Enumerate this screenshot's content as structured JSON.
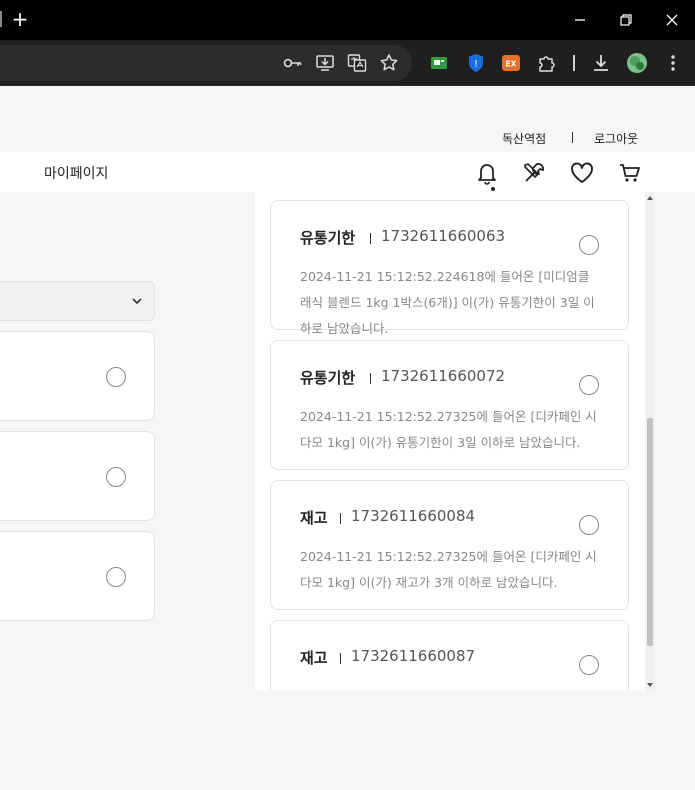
{
  "browser": {
    "new_tab_symbol": "+",
    "toolbar_icons": [
      "key-icon",
      "install-app-icon",
      "translate-icon",
      "bookmark-star-icon",
      "extension-green-icon",
      "shield-extension-icon",
      "ex-extension-icon",
      "puzzle-extensions-icon",
      "download-icon",
      "profile-avatar",
      "more-menu-icon"
    ],
    "ex_badge": "EX",
    "shield_badge": "!"
  },
  "header": {
    "util_links": [
      "독산역점",
      "로그아웃"
    ]
  },
  "nav": {
    "mypage_label": "마이페이지",
    "icons": [
      "bell-icon",
      "tools-icon",
      "heart-icon",
      "cart-icon"
    ]
  },
  "notifications": [
    {
      "type": "유통기한",
      "id": "1732611660063",
      "message": "2024-11-21 15:12:52.224618에 들어온 [미디엄클래식 블렌드 1kg 1박스(6개)] 이(가) 유통기한이 3일 이하로 남았습니다."
    },
    {
      "type": "유통기한",
      "id": "1732611660072",
      "message": "2024-11-21 15:12:52.27325에 들어온 [디카페인 시다모 1kg] 이(가) 유통기한이 3일 이하로 남았습니다."
    },
    {
      "type": "재고",
      "id": "1732611660084",
      "message": "2024-11-21 15:12:52.27325에 들어온 [디카페인 시다모 1kg] 이(가) 재고가 3개 이하로 남았습니다."
    },
    {
      "type": "재고",
      "id": "1732611660087",
      "message": ""
    }
  ],
  "colors": {
    "accent_chrome": "#1f1f1f",
    "text_muted": "#888888",
    "ex_extension": "#e8702a",
    "shield_extension": "#1a6fe0"
  }
}
